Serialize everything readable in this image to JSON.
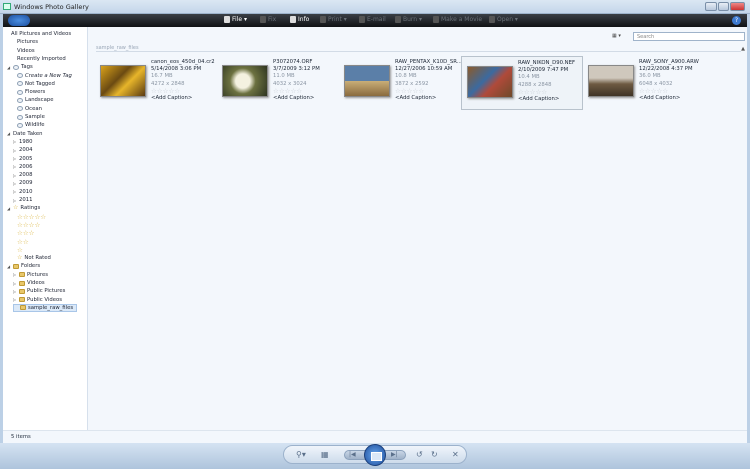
{
  "window": {
    "title": "Windows Photo Gallery"
  },
  "toolbar": {
    "file": "File ▾",
    "fix": "Fix",
    "info": "Info",
    "print": "Print ▾",
    "email": "E-mail",
    "burn": "Burn ▾",
    "movie": "Make a Movie",
    "open": "Open ▾"
  },
  "search": {
    "placeholder": "Search"
  },
  "sidebar": {
    "library": [
      "All Pictures and Videos",
      "Pictures",
      "Videos",
      "Recently Imported"
    ],
    "tags_label": "Tags",
    "tags": [
      "Create a New Tag",
      "Not Tagged",
      "Flowers",
      "Landscape",
      "Ocean",
      "Sample",
      "Wildlife"
    ],
    "date_label": "Date Taken",
    "dates": [
      "1980",
      "2004",
      "2005",
      "2006",
      "2008",
      "2009",
      "2010",
      "2011"
    ],
    "ratings_label": "Ratings",
    "ratings": [
      5,
      4,
      3,
      2,
      1
    ],
    "not_rated": "Not Rated",
    "folders_label": "Folders",
    "folders": [
      "Pictures",
      "Videos",
      "Public Pictures",
      "Public Videos",
      "sample_raw_files"
    ]
  },
  "group_header": "sample_raw_files",
  "items": [
    {
      "name": "canon_eos_450d_04.cr2",
      "date": "5/14/2008 3:06 PM",
      "size": "16.7 MB",
      "dims": "4272 x 2848",
      "caption": "<Add Caption>",
      "rating": 0
    },
    {
      "name": "P3072074.ORF",
      "date": "3/7/2009 3:12 PM",
      "size": "11.0 MB",
      "dims": "4032 x 3024",
      "caption": "<Add Caption>",
      "rating": 0
    },
    {
      "name": "RAW_PENTAX_K10D_SR...",
      "date": "12/27/2006 10:59 AM",
      "size": "10.8 MB",
      "dims": "3872 x 2592",
      "caption": "<Add Caption>",
      "rating": 0
    },
    {
      "name": "RAW_NIKON_D90.NEF",
      "date": "2/10/2009 7:47 PM",
      "size": "10.4 MB",
      "dims": "4288 x 2848",
      "caption": "<Add Caption>",
      "rating": 0
    },
    {
      "name": "RAW_SONY_A900.ARW",
      "date": "12/22/2008 4:37 PM",
      "size": "36.0 MB",
      "dims": "6048 x 4032",
      "caption": "<Add Caption>",
      "rating": 0
    }
  ],
  "status": "5 items",
  "colors": {
    "toolbar": "#15181c",
    "selection": "#dbe9f8",
    "star": "#d8b23a"
  }
}
